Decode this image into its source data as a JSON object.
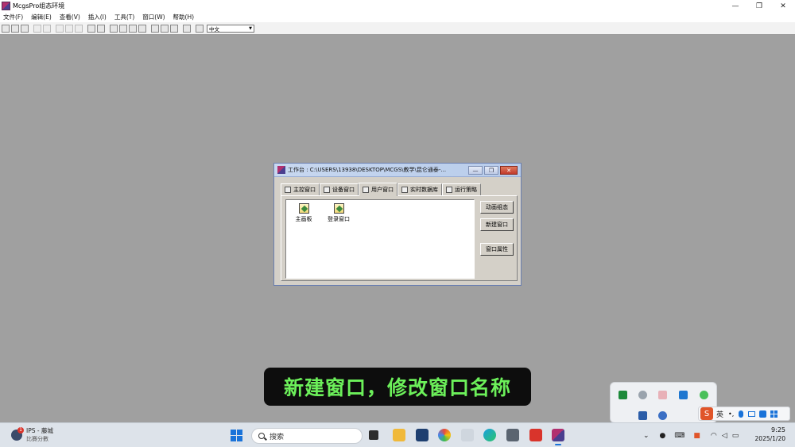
{
  "app": {
    "title": "McgsPro组态环境",
    "window_controls": {
      "minimize": "—",
      "maximize": "❐",
      "close": "✕"
    }
  },
  "menu": [
    {
      "label": "文件(F)"
    },
    {
      "label": "编辑(E)"
    },
    {
      "label": "查看(V)"
    },
    {
      "label": "插入(I)"
    },
    {
      "label": "工具(T)"
    },
    {
      "label": "窗口(W)"
    },
    {
      "label": "帮助(H)"
    }
  ],
  "toolbar": {
    "language_select": "中文"
  },
  "workbench": {
    "title": "工作台 : C:\\USERS\\13938\\DESKTOP\\MCGS\\教学\\昆仑通泰-...",
    "controls": {
      "minimize": "—",
      "restore": "❐",
      "close": "✕"
    },
    "tabs": [
      {
        "label": "主控窗口"
      },
      {
        "label": "设备窗口"
      },
      {
        "label": "用户窗口"
      },
      {
        "label": "实时数据库"
      },
      {
        "label": "运行策略"
      }
    ],
    "windows": [
      {
        "label": "主画板"
      },
      {
        "label": "登录窗口"
      }
    ],
    "buttons": {
      "animation": "动画组态",
      "new_window": "新建窗口",
      "properties": "窗口属性"
    }
  },
  "caption": "新建窗口，修改窗口名称",
  "taskbar": {
    "weather": {
      "badge": "1",
      "line1": "IPS - 藤城",
      "line2": "比賽分數"
    },
    "search_placeholder": "搜索",
    "clock": {
      "time": "9:25",
      "date": "2025/1/20"
    },
    "ime": "英"
  },
  "colors": {
    "caption_text": "#6cf05a",
    "desktop_bg": "#a0a0a0",
    "taskbar_bg": "#dde3ea",
    "accent": "#1a73d9"
  }
}
